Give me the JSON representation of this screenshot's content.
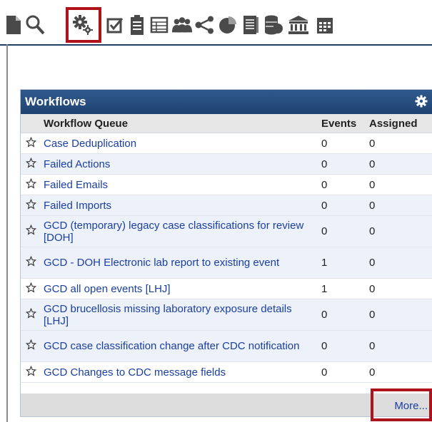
{
  "toolbar": {
    "icons": [
      "new-document-icon",
      "search-icon",
      "workflow-gears-icon",
      "task-checkbox-icon",
      "clipboard-icon",
      "table-icon",
      "people-icon",
      "share-icon",
      "pie-chart-icon",
      "reports-book-icon",
      "database-icon",
      "institution-icon",
      "calendar-icon"
    ],
    "selected": "workflow-gears-icon"
  },
  "panel": {
    "title": "Workflows",
    "columns": [
      "Workflow Queue",
      "Events",
      "Assigned"
    ],
    "rows": [
      {
        "name": "Case Deduplication",
        "events": "0",
        "assigned": "0"
      },
      {
        "name": "Failed Actions",
        "events": "0",
        "assigned": "0"
      },
      {
        "name": "Failed Emails",
        "events": "0",
        "assigned": "0"
      },
      {
        "name": "Failed Imports",
        "events": "0",
        "assigned": "0"
      },
      {
        "name": "GCD (temporary) legacy case classifications for review [DOH]",
        "events": "0",
        "assigned": "0"
      },
      {
        "name": "GCD - DOH Electronic lab report to existing event",
        "events": "1",
        "assigned": "0"
      },
      {
        "name": "GCD all open events [LHJ]",
        "events": "1",
        "assigned": "0"
      },
      {
        "name": "GCD brucellosis missing laboratory exposure details [LHJ]",
        "events": "0",
        "assigned": "0"
      },
      {
        "name": "GCD case classification change after CDC notification",
        "events": "0",
        "assigned": "0"
      },
      {
        "name": "GCD Changes to CDC message fields",
        "events": "0",
        "assigned": "0"
      }
    ],
    "more_label": "More..."
  },
  "colors": {
    "header": "#1f4372",
    "highlight": "#b0121b",
    "link": "#1a3fa3",
    "alt_row": "#edf1fa"
  }
}
